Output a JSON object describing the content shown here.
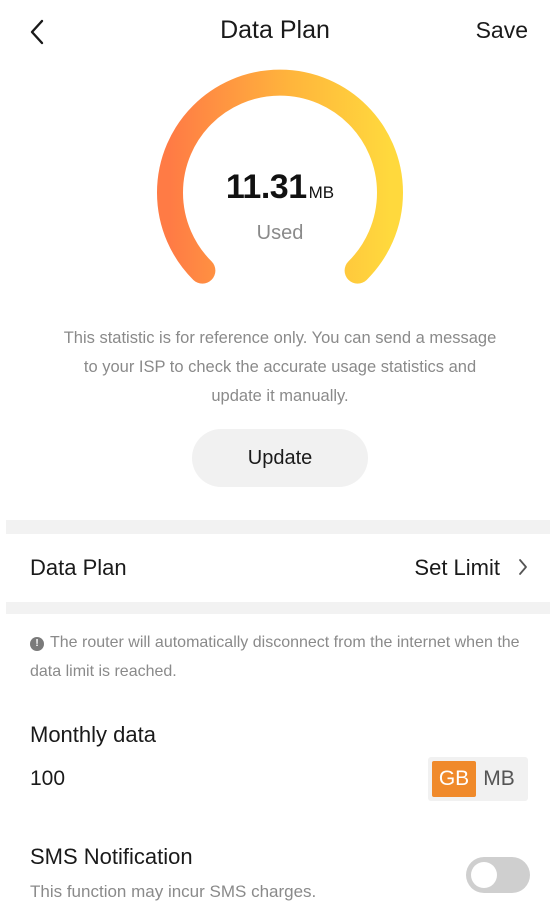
{
  "header": {
    "title": "Data Plan",
    "save_label": "Save",
    "back_icon": "chevron-left-icon"
  },
  "usage": {
    "value": "11.31",
    "unit": "MB",
    "label": "Used",
    "gauge_colors": [
      "#ff7b45",
      "#ffb53c",
      "#ffd93d"
    ]
  },
  "note": "This statistic is for reference only. You can send a message to your ISP to check the accurate usage statistics and update it manually.",
  "update_label": "Update",
  "plan_row": {
    "label": "Data Plan",
    "value": "Set Limit"
  },
  "info_text": "The router will automatically disconnect from the internet when the data limit is reached.",
  "monthly": {
    "label": "Monthly data",
    "value": "100",
    "units": [
      "GB",
      "MB"
    ],
    "selected_unit": "GB",
    "accent": "#f08a2b"
  },
  "sms": {
    "label": "SMS Notification",
    "sub": "This function may incur SMS charges.",
    "enabled": false
  }
}
